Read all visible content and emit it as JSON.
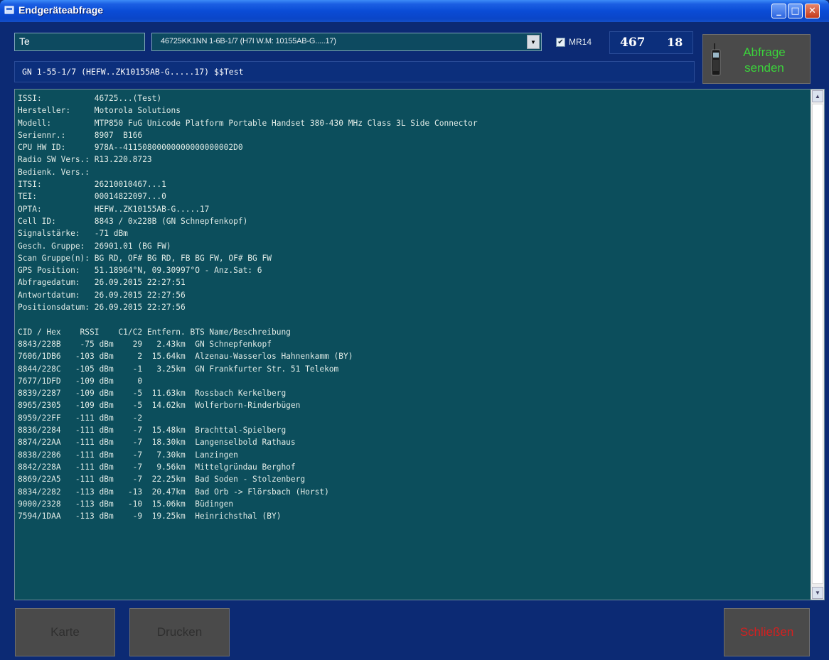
{
  "window": {
    "title": "Endgeräteabfrage",
    "buttons": {
      "minimize": "_",
      "maximize": "□",
      "close": "✕"
    }
  },
  "controls": {
    "name_value": "Te",
    "device_selected": "46725KK1NN 1-6B-1/7 (H7I W.M:  10155AB-G.....17)",
    "mr14_label": "MR14",
    "mr14_checked": "✔",
    "count_a": "467",
    "count_b": "18",
    "query_button": {
      "line1": "Abfrage",
      "line2": "senden"
    }
  },
  "selected_line": "GN 1-55-1/7 (HEFW..ZK10155AB-G.....17) $$Test",
  "info_lines": [
    "ISSI:           46725...(Test)",
    "Hersteller:     Motorola Solutions",
    "Modell:         MTP850 FuG Unicode Platform Portable Handset 380-430 MHz Class 3L Side Connector",
    "Seriennr.:      8907  B166",
    "CPU HW ID:      978A--41150800000000000000002D0",
    "Radio SW Vers.: R13.220.8723",
    "Bedienk. Vers.:",
    "ITSI:           26210010467...1",
    "TEI:            00014822097...0",
    "OPTA:           HEFW..ZK10155AB-G.....17",
    "Cell ID:        8843 / 0x228B (GN Schnepfenkopf)",
    "Signalstärke:   -71 dBm",
    "Gesch. Gruppe:  26901.01 (BG FW)",
    "Scan Gruppe(n): BG RD, OF# BG RD, FB BG FW, OF# BG FW",
    "GPS Position:   51.18964°N, 09.30997°O - Anz.Sat: 6",
    "Abfragedatum:   26.09.2015 22:27:51",
    "Antwortdatum:   26.09.2015 22:27:56",
    "Positionsdatum: 26.09.2015 22:27:56",
    "",
    "CID / Hex    RSSI    C1/C2 Entfern. BTS Name/Beschreibung",
    "8843/228B    -75 dBm    29   2.43km  GN Schnepfenkopf",
    "7606/1DB6   -103 dBm     2  15.64km  Alzenau-Wasserlos Hahnenkamm (BY)",
    "8844/228C   -105 dBm    -1   3.25km  GN Frankfurter Str. 51 Telekom",
    "7677/1DFD   -109 dBm     0",
    "8839/2287   -109 dBm    -5  11.63km  Rossbach Kerkelberg",
    "8965/2305   -109 dBm    -5  14.62km  Wolferborn-Rinderbügen",
    "8959/22FF   -111 dBm    -2",
    "8836/2284   -111 dBm    -7  15.48km  Brachttal-Spielberg",
    "8874/22AA   -111 dBm    -7  18.30km  Langenselbold Rathaus",
    "8838/2286   -111 dBm    -7   7.30km  Lanzingen",
    "8842/228A   -111 dBm    -7   9.56km  Mittelgründau Berghof",
    "8869/22A5   -111 dBm    -7  22.25km  Bad Soden - Stolzenberg",
    "8834/2282   -113 dBm   -13  20.47km  Bad Orb -> Flörsbach (Horst)",
    "9000/2328   -113 dBm   -10  15.06km  Büdingen",
    "7594/1DAA   -113 dBm    -9  19.25km  Heinrichsthal (BY)"
  ],
  "bottom_buttons": {
    "map": "Karte",
    "print": "Drucken",
    "close": "Schließen"
  },
  "colors": {
    "window_bg": "#0c2a74",
    "panel_bg": "#0c4e5c",
    "query_text": "#3bd23b",
    "close_text": "#d32020"
  }
}
